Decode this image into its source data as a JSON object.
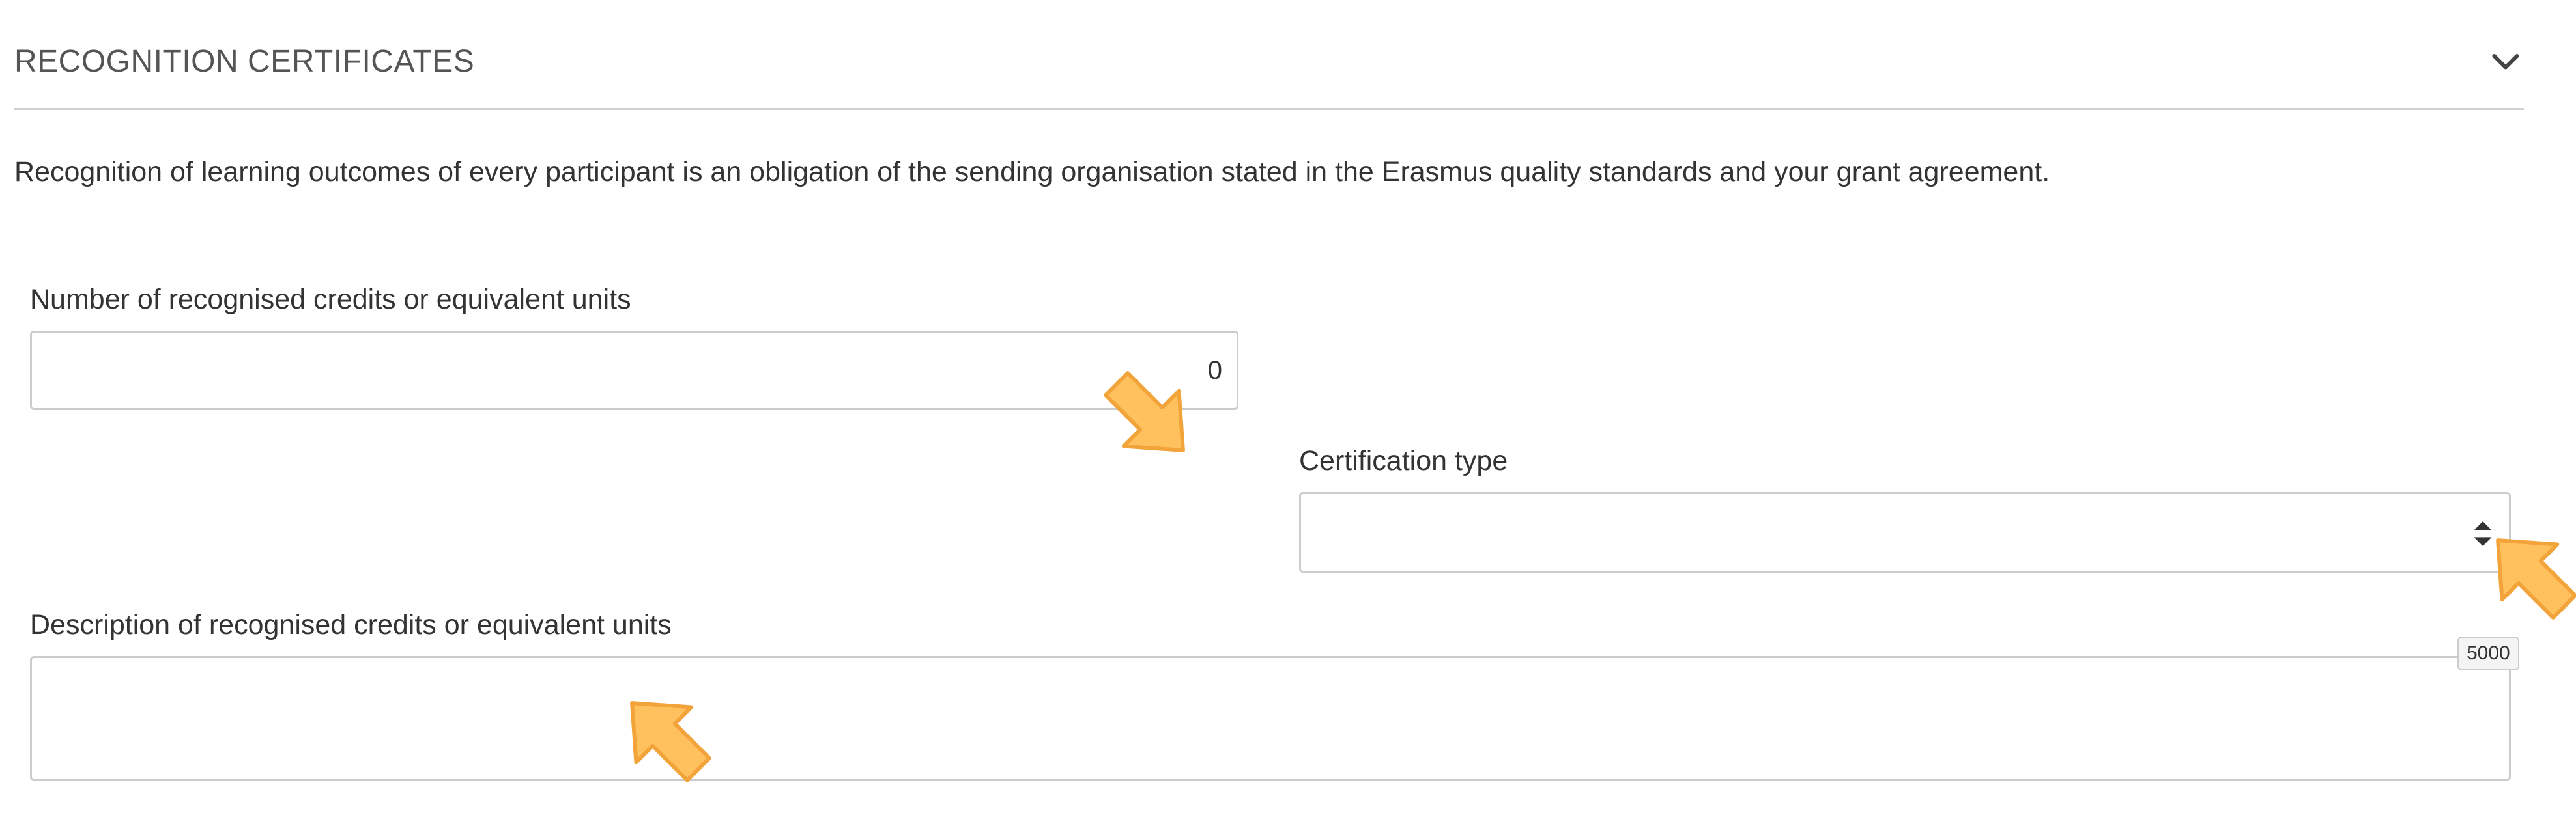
{
  "section": {
    "title": "RECOGNITION CERTIFICATES",
    "toggle_icon": "chevron-down-icon"
  },
  "intro_text": "Recognition of learning outcomes of every participant is an obligation of the sending organisation stated in the Erasmus quality standards and your grant agreement.",
  "fields": {
    "credits": {
      "label": "Number of recognised credits or equivalent units",
      "value": "0"
    },
    "certification_type": {
      "label": "Certification type",
      "selected": "",
      "icon": "sort-arrows-icon"
    },
    "description": {
      "label": "Description of recognised credits or equivalent units",
      "value": "",
      "char_counter": "5000"
    }
  },
  "annotations": {
    "pointer_icon": "orange-arrow-pointer-icon",
    "color_fill": "#FFC15E",
    "color_stroke": "#F2A33A"
  }
}
